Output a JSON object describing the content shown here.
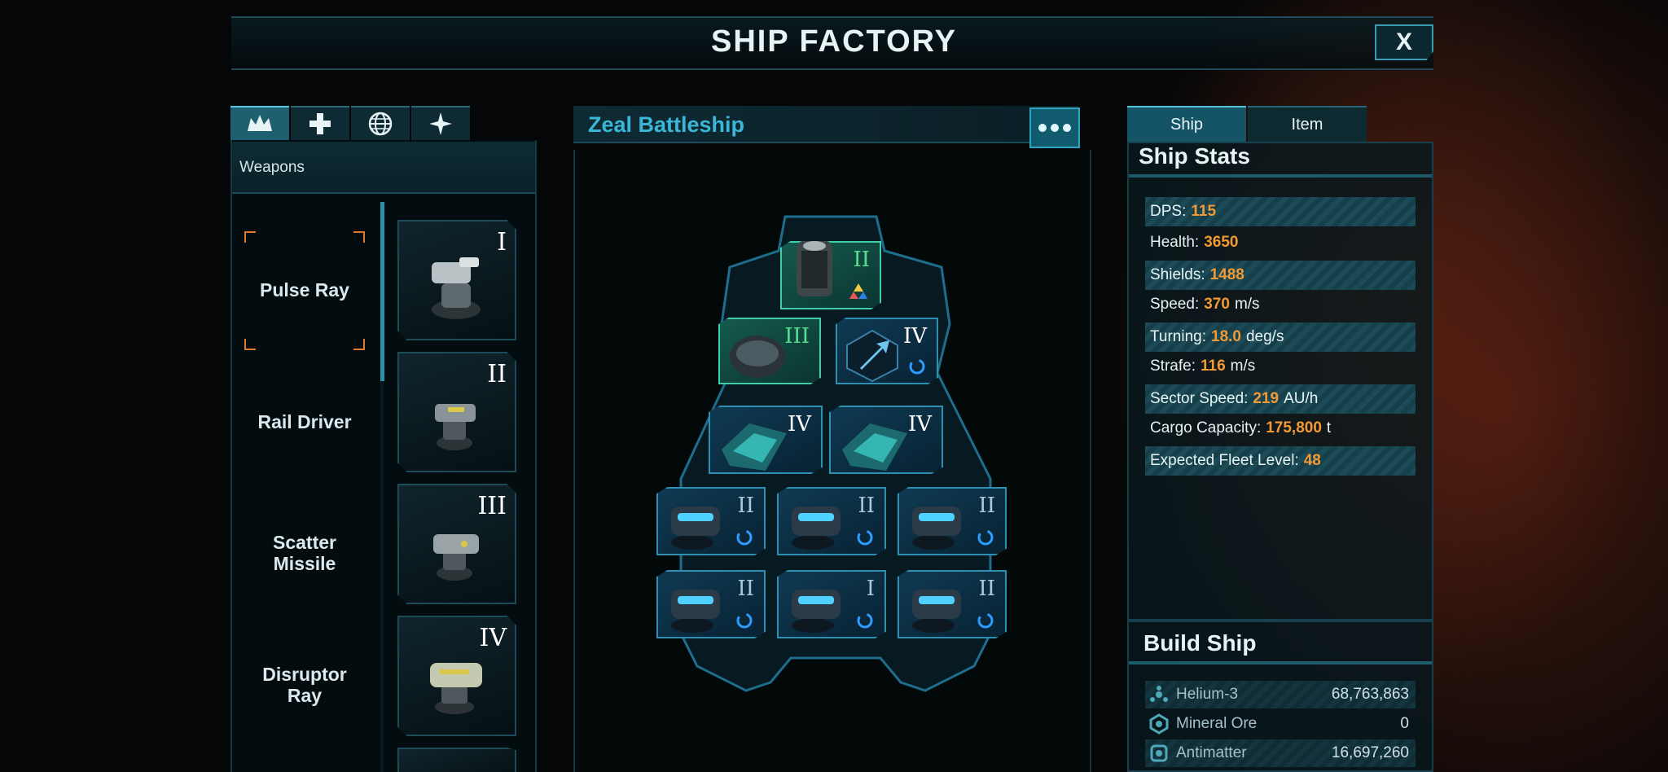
{
  "header": {
    "title": "SHIP FACTORY",
    "close_label": "X"
  },
  "left_panel": {
    "category_tabs": [
      {
        "icon": "crown-icon",
        "active": true
      },
      {
        "icon": "plus-icon",
        "active": false
      },
      {
        "icon": "globe-icon",
        "active": false
      },
      {
        "icon": "star-icon",
        "active": false
      }
    ],
    "section_label": "Weapons",
    "weapons": [
      {
        "name": "Pulse Ray",
        "tier": "I",
        "selected": true
      },
      {
        "name": "Rail Driver",
        "tier": "II",
        "selected": false
      },
      {
        "name": "Scatter\nMissile",
        "tier": "III",
        "selected": false
      },
      {
        "name": "Disruptor\nRay",
        "tier": "IV",
        "selected": false
      }
    ]
  },
  "center_panel": {
    "ship_name": "Zeal Battleship",
    "slots": [
      {
        "id": "core",
        "tier": "II",
        "color": "green"
      },
      {
        "id": "hull",
        "tier": "III",
        "color": "green"
      },
      {
        "id": "booster",
        "tier": "IV",
        "color": "white"
      },
      {
        "id": "armor-left",
        "tier": "IV",
        "color": "white"
      },
      {
        "id": "armor-right",
        "tier": "IV",
        "color": "white"
      },
      {
        "id": "weapon-1",
        "tier": "II",
        "color": "blue"
      },
      {
        "id": "weapon-2",
        "tier": "II",
        "color": "blue"
      },
      {
        "id": "weapon-3",
        "tier": "II",
        "color": "blue"
      },
      {
        "id": "weapon-4",
        "tier": "II",
        "color": "blue"
      },
      {
        "id": "weapon-5",
        "tier": "I",
        "color": "blue"
      },
      {
        "id": "weapon-6",
        "tier": "II",
        "color": "blue"
      }
    ]
  },
  "right_panel": {
    "tabs": [
      "Ship",
      "Item"
    ],
    "stats_title": "Ship Stats",
    "stats": [
      {
        "label": "DPS:",
        "value": "115",
        "unit": ""
      },
      {
        "label": "Health:",
        "value": "3650",
        "unit": ""
      },
      {
        "label": "Shields:",
        "value": "1488",
        "unit": ""
      },
      {
        "label": "Speed:",
        "value": "370",
        "unit": "m/s"
      },
      {
        "label": "Turning:",
        "value": "18.0",
        "unit": "deg/s"
      },
      {
        "label": "Strafe:",
        "value": "116",
        "unit": "m/s"
      },
      {
        "label": "Sector Speed:",
        "value": "219",
        "unit": "AU/h"
      },
      {
        "label": "Cargo Capacity:",
        "value": "175,800",
        "unit": "t"
      },
      {
        "label": "Expected Fleet Level:",
        "value": "48",
        "unit": ""
      }
    ],
    "build_title": "Build Ship",
    "resources": [
      {
        "name": "Helium-3",
        "amount": "68,763,863",
        "icon": "helium-icon"
      },
      {
        "name": "Mineral Ore",
        "amount": "0",
        "icon": "ore-icon"
      },
      {
        "name": "Antimatter",
        "amount": "16,697,260",
        "icon": "antimatter-icon"
      }
    ]
  },
  "colors": {
    "accent": "#3ab7d6",
    "value": "#f39a35",
    "selection": "#e07b2e",
    "green_tier": "#55e08f"
  }
}
